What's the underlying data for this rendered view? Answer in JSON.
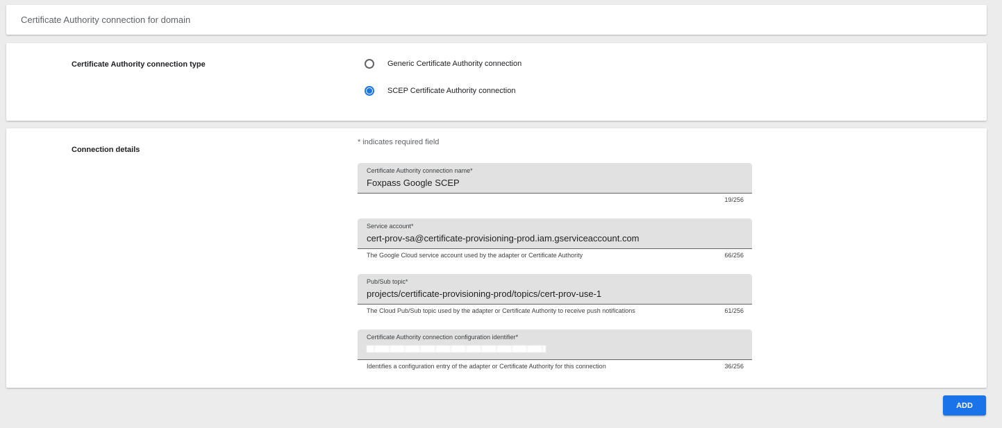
{
  "header": {
    "title": "Certificate Authority connection for domain"
  },
  "connection_type": {
    "label": "Certificate Authority connection type",
    "options": [
      {
        "label": "Generic Certificate Authority connection",
        "selected": false
      },
      {
        "label": "SCEP Certificate Authority connection",
        "selected": true
      }
    ]
  },
  "details": {
    "label": "Connection details",
    "required_note": "* indicates required field",
    "fields": [
      {
        "label": "Certificate Authority connection name*",
        "value": "Foxpass Google SCEP",
        "helper": "",
        "counter": "19/256"
      },
      {
        "label": "Service account*",
        "value": "cert-prov-sa@certificate-provisioning-prod.iam.gserviceaccount.com",
        "helper": "The Google Cloud service account used by the adapter or Certificate Authority",
        "counter": "66/256"
      },
      {
        "label": "Pub/Sub topic*",
        "value": "projects/certificate-provisioning-prod/topics/cert-prov-use-1",
        "helper": "The Cloud Pub/Sub topic used by the adapter or Certificate Authority to receive push notifications",
        "counter": "61/256"
      },
      {
        "label": "Certificate Authority connection configuration identifier*",
        "value": "",
        "helper": "Identifies a configuration entry of the adapter or Certificate Authority for this connection",
        "counter": "36/256"
      }
    ]
  },
  "actions": {
    "add_label": "ADD"
  },
  "colors": {
    "accent": "#1a73e8",
    "field_bg": "#e1e1e1",
    "page_bg": "#ececec"
  }
}
